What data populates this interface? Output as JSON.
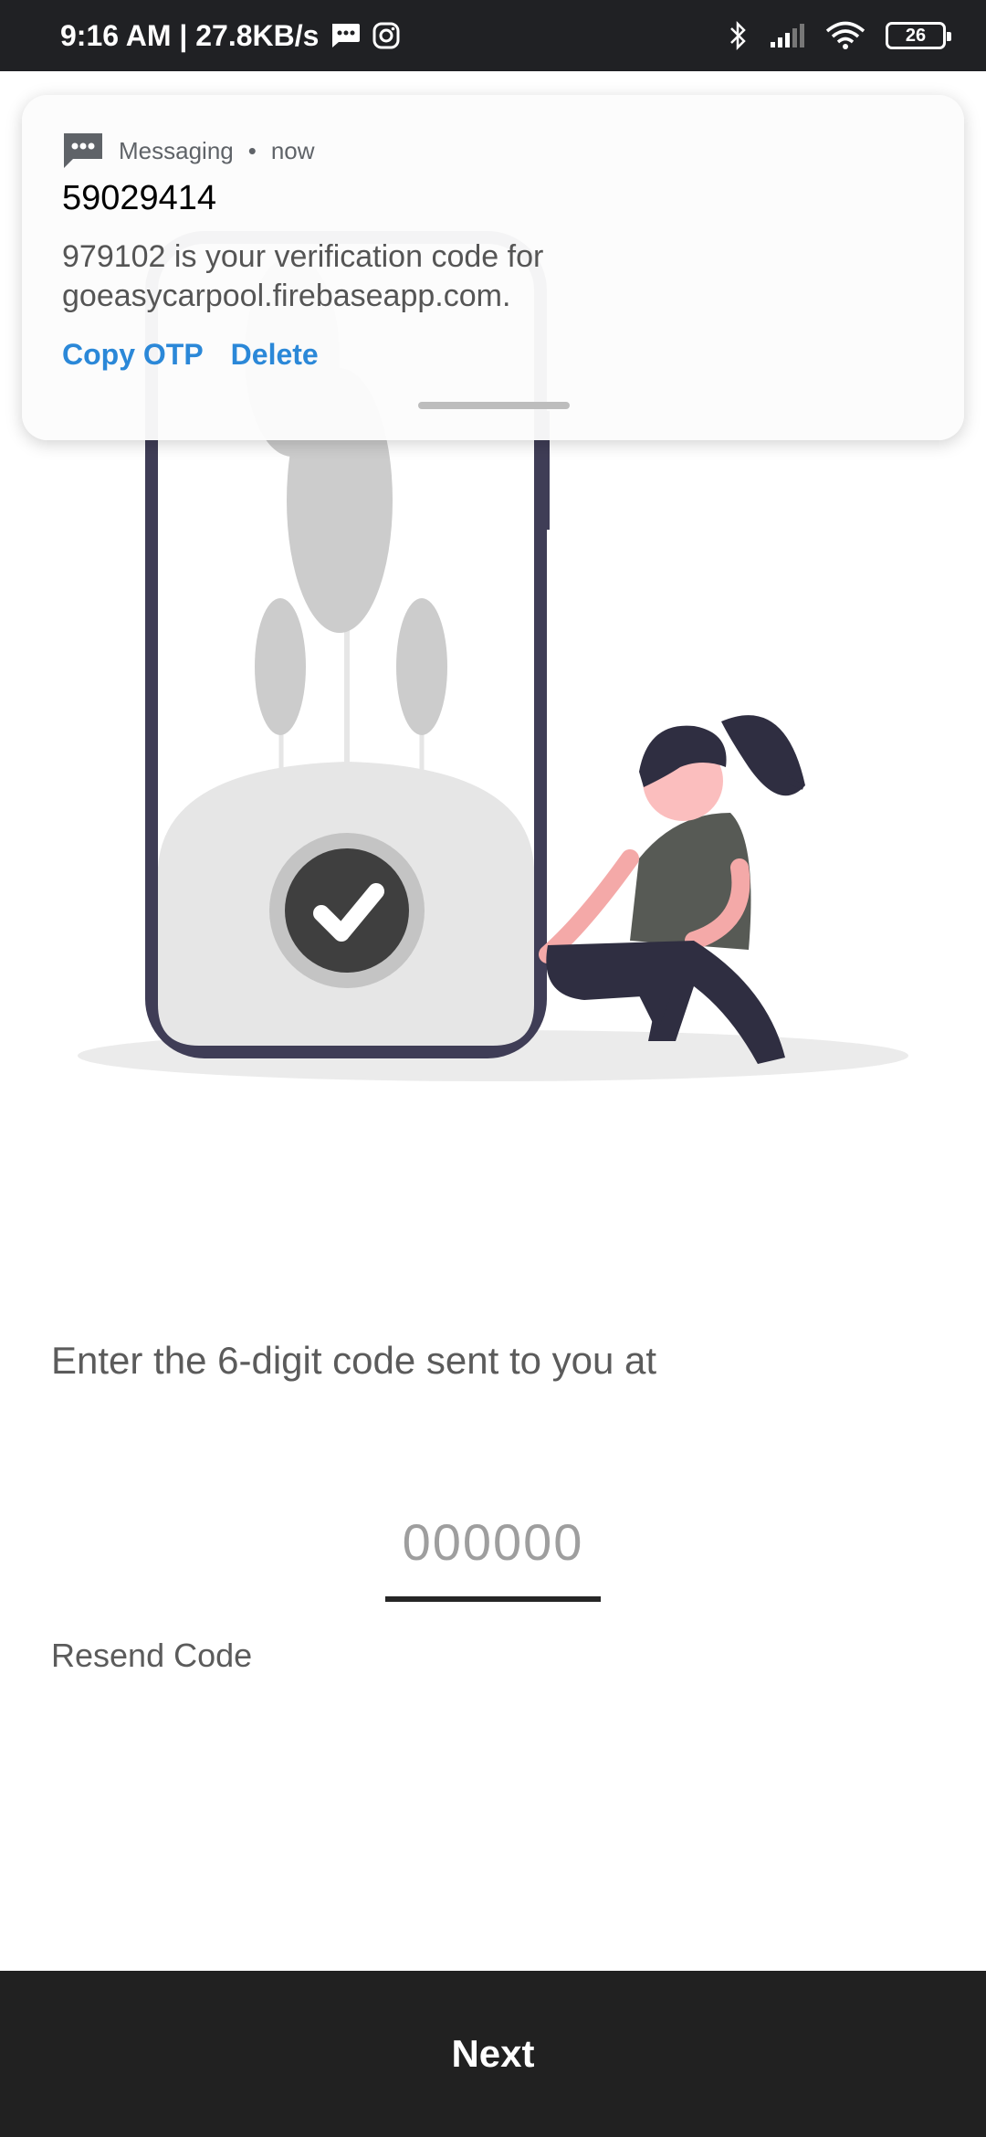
{
  "status_bar": {
    "time_speed": "9:16 AM | 27.8KB/s",
    "battery": "26",
    "icons": [
      "messaging-icon",
      "instagram-icon",
      "bluetooth-icon",
      "signal-icon",
      "wifi-icon",
      "battery-icon"
    ]
  },
  "notification": {
    "app_name": "Messaging",
    "separator": "•",
    "time": "now",
    "title": "59029414",
    "body": "979102 is your verification code for goeasycarpool.firebaseapp.com.",
    "actions": [
      "Copy OTP",
      "Delete"
    ]
  },
  "verification": {
    "prompt": "Enter the 6-digit code sent to you at",
    "code_placeholder": "000000",
    "resend_label": "Resend Code"
  },
  "footer": {
    "next_label": "Next"
  },
  "colors": {
    "status_bar": "#202124",
    "action_blue": "#2b88d8",
    "button_dark": "#212121",
    "phone_frame": "#3f3d56"
  }
}
